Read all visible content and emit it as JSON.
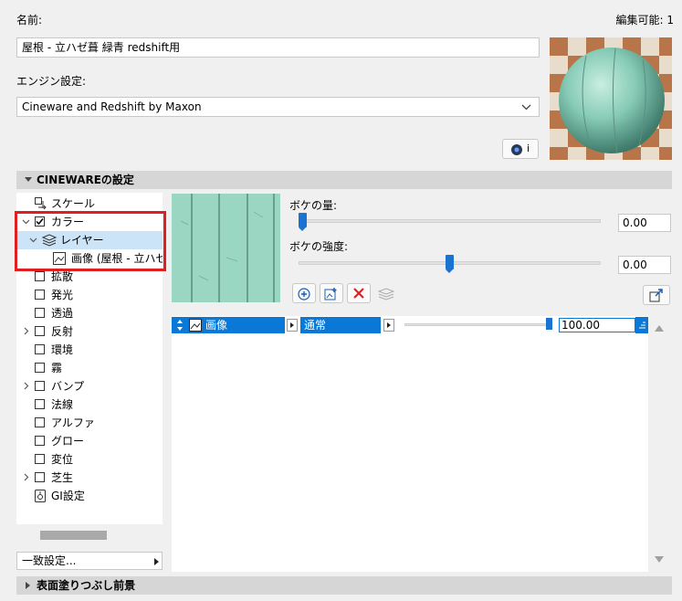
{
  "header": {
    "name_label": "名前:",
    "editable": "編集可能: 1",
    "name_value": "屋根 - 立ハゼ葺 緑青 redshift用"
  },
  "engine": {
    "label": "エンジン設定:",
    "value": "Cineware and Redshift by Maxon"
  },
  "info_button_label": "i",
  "section_cineware": "CINEWAREの設定",
  "section_bottom": "表面塗りつぶし前景",
  "tree": {
    "items": [
      {
        "label": "スケール"
      },
      {
        "label": "カラー",
        "checked": true
      },
      {
        "label": "レイヤー"
      },
      {
        "label": "画像 (屋根 - 立ハゼ"
      },
      {
        "label": "拡散"
      },
      {
        "label": "発光"
      },
      {
        "label": "透過"
      },
      {
        "label": "反射"
      },
      {
        "label": "環境"
      },
      {
        "label": "霧"
      },
      {
        "label": "バンプ"
      },
      {
        "label": "法線"
      },
      {
        "label": "アルファ"
      },
      {
        "label": "グロー"
      },
      {
        "label": "変位"
      },
      {
        "label": "芝生"
      },
      {
        "label": "GI設定"
      }
    ]
  },
  "params": {
    "bokeh_amount_label": "ボケの量:",
    "bokeh_amount_value": "0.00",
    "bokeh_amount_level": 0,
    "bokeh_strength_label": "ボケの強度:",
    "bokeh_strength_value": "0.00",
    "bokeh_strength_level": 0.5
  },
  "layer_row": {
    "name": "画像",
    "mode": "通常",
    "value": "100.00",
    "level": 1.0
  },
  "preset_select": "一致設定...",
  "colors": {
    "accent": "#0a78d7",
    "highlight_red": "#e02020",
    "selected_row": "#cce4f7"
  }
}
